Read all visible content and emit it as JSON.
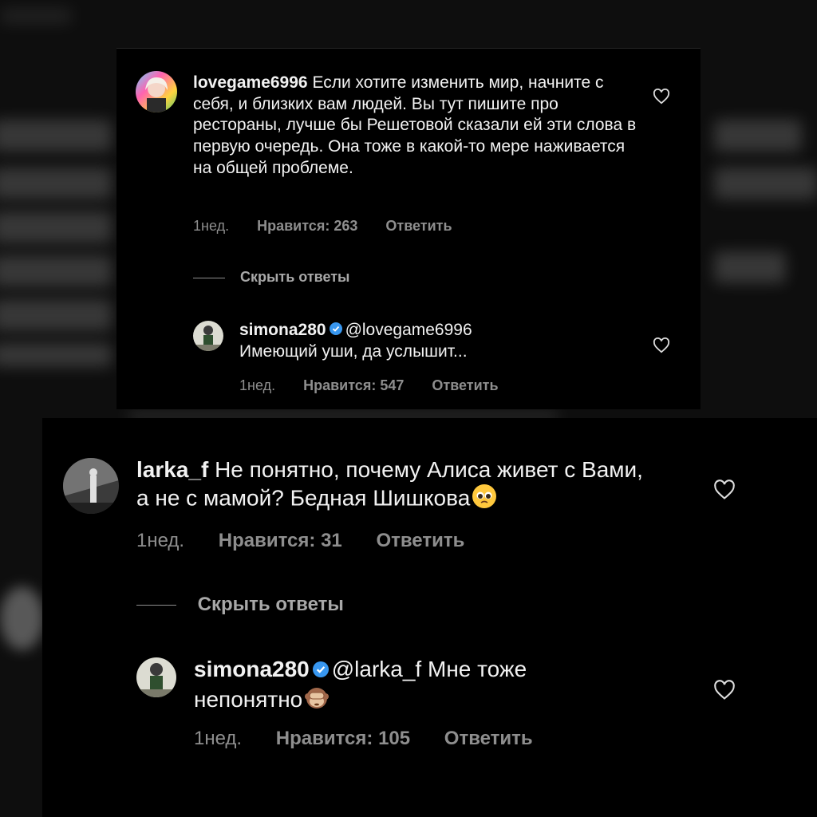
{
  "comments": [
    {
      "username": "lovegame6996",
      "text": "Если хотите изменить мир, начните с себя, и близких вам людей. Вы тут пишите про рестораны, лучше бы Решетовой сказали ей эти слова в первую очередь. Она тоже в какой-то мере наживается на общей проблеме.",
      "time": "1нед.",
      "likes": "Нравится: 263",
      "reply_label": "Ответить",
      "hide_replies_label": "Скрыть ответы",
      "reply": {
        "username": "simona280",
        "verified": true,
        "mention": "@lovegame6996",
        "text": "Имеющий уши, да услышит...",
        "time": "1нед.",
        "likes": "Нравится: 547",
        "reply_label": "Ответить"
      }
    },
    {
      "username": "larka_f",
      "text": "Не понятно, почему Алиса живет с Вами, а не с мамой? Бедная Шишкова",
      "emoji": "pleading-face",
      "time": "1нед.",
      "likes": "Нравится: 31",
      "reply_label": "Ответить",
      "hide_replies_label": "Скрыть ответы",
      "reply": {
        "username": "simona280",
        "verified": true,
        "mention": "@larka_f",
        "text": "Мне тоже непонятно",
        "emoji": "see-no-evil-monkey",
        "time": "1нед.",
        "likes": "Нравится: 105",
        "reply_label": "Ответить"
      }
    }
  ],
  "colors": {
    "background": "#000000",
    "text": "#f2f2f2",
    "meta": "#8e8e8e",
    "verified": "#3897f0"
  }
}
